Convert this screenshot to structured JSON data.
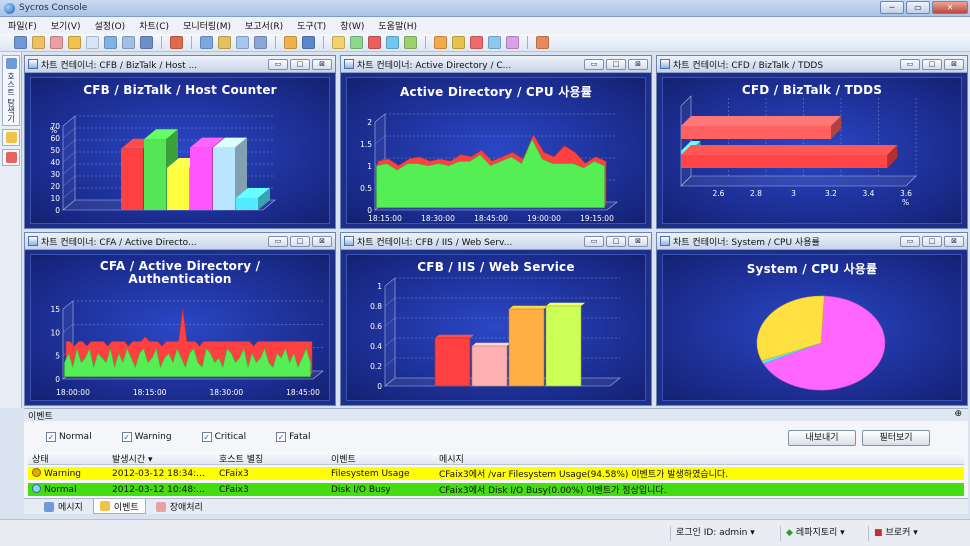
{
  "window": {
    "title": "Sycros Console",
    "controls": [
      "─",
      "▭",
      "✕"
    ]
  },
  "menu": [
    "파일(F)",
    "보기(V)",
    "설정(O)",
    "차트(C)",
    "모니터링(M)",
    "보고서(R)",
    "도구(T)",
    "창(W)",
    "도움말(H)"
  ],
  "sidebar": {
    "tabs": [
      {
        "label": "호스트 탐색기",
        "icon": "host-explorer-icon"
      },
      {
        "label": "",
        "icon": "folder-icon"
      },
      {
        "label": "",
        "icon": "chart-icon"
      }
    ]
  },
  "panels": [
    {
      "header": "차트 컨테이너: CFB / BizTalk / Host ...",
      "title": "CFB / BizTalk / Host Counter"
    },
    {
      "header": "차트 컨테이너: Active Directory / C...",
      "title": "Active  Directory / CPU 사용률"
    },
    {
      "header": "차트 컨테이너: CFD / BizTalk / TDDS",
      "title": "CFD / BizTalk / TDDS"
    },
    {
      "header": "차트 컨테이너: CFA / Active Directo...",
      "title_line1": "CFA / Active  Directory /",
      "title_line2": "Authentication"
    },
    {
      "header": "차트 컨테이너: CFB / IIS / Web Serv...",
      "title": "CFB / IIS / Web Service"
    },
    {
      "header": "차트 컨테이너: System / CPU 사용률",
      "title": "System / CPU 사용률"
    }
  ],
  "panel_buttons": [
    "▭",
    "□",
    "⊠"
  ],
  "chart_data": [
    {
      "type": "bar",
      "title": "CFB / BizTalk / Host Counter",
      "ylabel": "%",
      "ylim": [
        0,
        70
      ],
      "yticks": [
        "0",
        "10",
        "20",
        "30",
        "40",
        "50",
        "60",
        "70"
      ],
      "values": [
        51,
        59,
        35,
        52,
        52,
        10
      ],
      "colors": [
        "#ff4040",
        "#55e655",
        "#ffff40",
        "#ff55ff",
        "#b8e6ff",
        "#55eaff"
      ]
    },
    {
      "type": "area",
      "title": "Active  Directory / CPU 사용률",
      "ylim": [
        0,
        2
      ],
      "yticks": [
        "0",
        "0.5",
        "1",
        "1.5",
        "2"
      ],
      "xticks": [
        "18:15:00",
        "18:30:00",
        "18:45:00",
        "19:00:00",
        "19:15:00"
      ],
      "series": [
        {
          "color": "#ff4040",
          "values": [
            1.0,
            1.05,
            0.9,
            1.05,
            1.1,
            1.0,
            1.05,
            1.0,
            1.15,
            1.1,
            1.25,
            1.0,
            1.1,
            1.2,
            1.05,
            1.6,
            1.2,
            1.1,
            1.35,
            1.2,
            0.95,
            1.1,
            1.0
          ]
        },
        {
          "color": "#55ee55",
          "values": [
            0.95,
            1.0,
            0.85,
            1.0,
            1.0,
            0.95,
            1.0,
            0.95,
            1.05,
            1.05,
            1.2,
            0.95,
            1.05,
            1.15,
            1.0,
            1.55,
            1.1,
            1.0,
            1.0,
            1.0,
            0.9,
            1.05,
            0.95
          ]
        }
      ]
    },
    {
      "type": "bar",
      "title": "CFD / BizTalk / TDDS",
      "orientation": "horizontal",
      "xlabel": "%",
      "xlim": [
        2.4,
        3.6
      ],
      "xticks": [
        "2.6",
        "2.8",
        "3",
        "3.2",
        "3.4",
        "3.6"
      ],
      "values": [
        3.2,
        2.45,
        3.5
      ],
      "colors": [
        "#ff6060",
        "#55eaff",
        "#ff4545"
      ]
    },
    {
      "type": "area",
      "title": "CFA / Active  Directory / Authentication",
      "ylim": [
        0,
        15
      ],
      "yticks": [
        "0",
        "5",
        "10",
        "15"
      ],
      "xticks": [
        "18:00:00",
        "18:15:00",
        "18:30:00",
        "18:45:00"
      ],
      "series": [
        {
          "color": "#ff4040",
          "values": [
            7,
            7,
            6,
            7,
            7,
            6,
            7,
            7,
            7,
            7,
            6,
            7,
            7,
            7,
            7,
            6,
            7,
            7,
            7,
            8,
            7,
            7,
            7,
            6,
            7,
            7,
            7,
            7,
            14,
            7,
            7,
            7,
            6,
            7,
            7,
            7,
            7,
            7,
            7,
            7,
            7,
            7,
            7,
            7,
            7,
            6,
            7,
            7,
            7,
            7,
            7,
            7,
            7,
            7,
            7,
            7,
            7,
            7,
            7,
            7
          ]
        },
        {
          "color": "#55ee55",
          "values": [
            3,
            5,
            2,
            6,
            3,
            4,
            6,
            2,
            5,
            4,
            3,
            6,
            2,
            5,
            3,
            6,
            4,
            2,
            5,
            6,
            3,
            4,
            6,
            2,
            4,
            5,
            3,
            6,
            4,
            2,
            5,
            6,
            3,
            2,
            6,
            5,
            3,
            4,
            2,
            6,
            5,
            3,
            4,
            6,
            2,
            5,
            3,
            4,
            6,
            3,
            2,
            5,
            4,
            6,
            3,
            5,
            2,
            4,
            6,
            3
          ]
        }
      ]
    },
    {
      "type": "bar",
      "title": "CFB / IIS / Web Service",
      "ylim": [
        0,
        1
      ],
      "yticks": [
        "0",
        "0.2",
        "0.4",
        "0.6",
        "0.8",
        "1"
      ],
      "values": [
        0.48,
        0.4,
        0.77,
        0.8
      ],
      "colors": [
        "#ff4040",
        "#ffb0b0",
        "#ffb040",
        "#ccff55"
      ]
    },
    {
      "type": "pie",
      "title": "System / CPU 사용률",
      "values": [
        67,
        1,
        32
      ],
      "colors": [
        "#ff66ff",
        "#55eaff",
        "#ffe040"
      ]
    }
  ],
  "events": {
    "section_label": "이벤트",
    "filters": [
      {
        "label": "Normal",
        "checked": true
      },
      {
        "label": "Warning",
        "checked": true
      },
      {
        "label": "Critical",
        "checked": true
      },
      {
        "label": "Fatal",
        "checked": true
      }
    ],
    "export_button": "내보내기",
    "filter_button": "필터보기",
    "columns": [
      "상태",
      "발생시간",
      "호스트 별칭",
      "이벤트",
      "메시지"
    ],
    "rows": [
      {
        "status": "Warning",
        "time": "2012-03-12 18:34:...",
        "host": "CFaix3",
        "event": "Filesystem Usage",
        "message": "CFaix3에서 /var Filesystem Usage(94.58%) 이벤트가 발생하였습니다.",
        "bg": "#ffff00"
      },
      {
        "status": "Normal",
        "time": "2012-03-12 10:48:...",
        "host": "CFaix3",
        "event": "Disk I/O Busy",
        "message": "CFaix3에서  Disk I/O Busy(0.00%) 이벤트가 정상입니다.",
        "bg": "#44dd11"
      }
    ]
  },
  "bottom_tabs": [
    {
      "label": "메시지",
      "active": false
    },
    {
      "label": "이벤트",
      "active": true
    },
    {
      "label": "장애처리",
      "active": false
    }
  ],
  "status": {
    "login": "로그인 ID: admin ▾",
    "repository": "레파지토리 ▾",
    "broker": "브로커 ▾"
  }
}
